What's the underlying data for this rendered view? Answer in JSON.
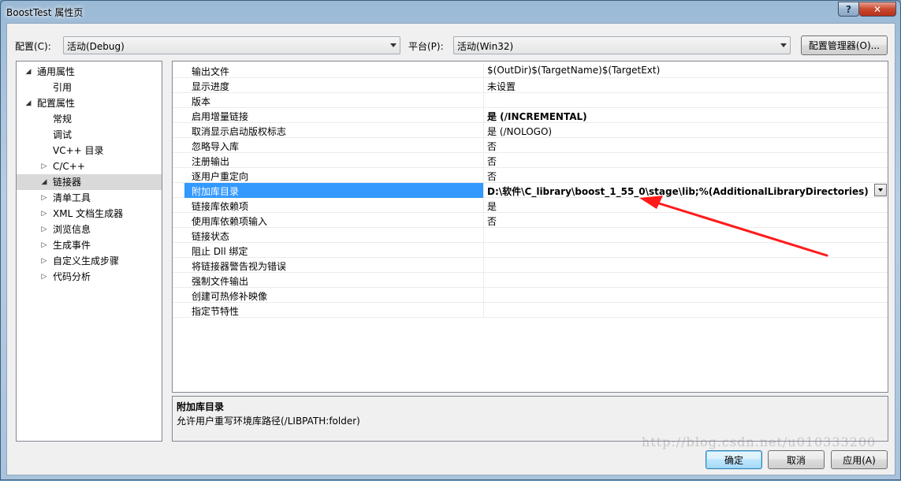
{
  "window": {
    "title": "BoostTest 属性页"
  },
  "toolbar": {
    "config_label": "配置(C):",
    "config_value": "活动(Debug)",
    "platform_label": "平台(P):",
    "platform_value": "活动(Win32)",
    "config_manager_label": "配置管理器(O)..."
  },
  "tree": {
    "items": [
      {
        "label": "通用属性",
        "toggle": "◢",
        "level": 0
      },
      {
        "label": "引用",
        "toggle": "",
        "level": 1
      },
      {
        "label": "配置属性",
        "toggle": "◢",
        "level": 0
      },
      {
        "label": "常规",
        "toggle": "",
        "level": 1
      },
      {
        "label": "调试",
        "toggle": "",
        "level": 1
      },
      {
        "label": "VC++ 目录",
        "toggle": "",
        "level": 1
      },
      {
        "label": "C/C++",
        "toggle": "▷",
        "level": 1
      },
      {
        "label": "链接器",
        "toggle": "◢",
        "level": 1,
        "selected": true
      },
      {
        "label": "清单工具",
        "toggle": "▷",
        "level": 1
      },
      {
        "label": "XML 文档生成器",
        "toggle": "▷",
        "level": 1
      },
      {
        "label": "浏览信息",
        "toggle": "▷",
        "level": 1
      },
      {
        "label": "生成事件",
        "toggle": "▷",
        "level": 1
      },
      {
        "label": "自定义生成步骤",
        "toggle": "▷",
        "level": 1
      },
      {
        "label": "代码分析",
        "toggle": "▷",
        "level": 1
      }
    ]
  },
  "grid": {
    "rows": [
      {
        "name": "输出文件",
        "value": "$(OutDir)$(TargetName)$(TargetExt)",
        "bold": false
      },
      {
        "name": "显示进度",
        "value": "未设置",
        "bold": false
      },
      {
        "name": "版本",
        "value": "",
        "bold": false
      },
      {
        "name": "启用增量链接",
        "value": "是 (/INCREMENTAL)",
        "bold": true
      },
      {
        "name": "取消显示启动版权标志",
        "value": "是 (/NOLOGO)",
        "bold": false
      },
      {
        "name": "忽略导入库",
        "value": "否",
        "bold": false
      },
      {
        "name": "注册输出",
        "value": "否",
        "bold": false
      },
      {
        "name": "逐用户重定向",
        "value": "否",
        "bold": false
      },
      {
        "name": "附加库目录",
        "value": "D:\\软件\\C_library\\boost_1_55_0\\stage\\lib;%(AdditionalLibraryDirectories)",
        "bold": true,
        "selected": true
      },
      {
        "name": "链接库依赖项",
        "value": "是",
        "bold": false
      },
      {
        "name": "使用库依赖项输入",
        "value": "否",
        "bold": false
      },
      {
        "name": "链接状态",
        "value": "",
        "bold": false
      },
      {
        "name": "阻止 Dll 绑定",
        "value": "",
        "bold": false
      },
      {
        "name": "将链接器警告视为错误",
        "value": "",
        "bold": false
      },
      {
        "name": "强制文件输出",
        "value": "",
        "bold": false
      },
      {
        "name": "创建可热修补映像",
        "value": "",
        "bold": false
      },
      {
        "name": "指定节特性",
        "value": "",
        "bold": false
      }
    ]
  },
  "description": {
    "title": "附加库目录",
    "body": "允许用户重写环境库路径(/LIBPATH:folder)"
  },
  "buttons": {
    "ok": "确定",
    "cancel": "取消",
    "apply": "应用(A)"
  },
  "watermark": "http://blog.csdn.net/u010333200",
  "colors": {
    "selection": "#3399ff",
    "annotation_arrow": "#ff1a1a"
  }
}
